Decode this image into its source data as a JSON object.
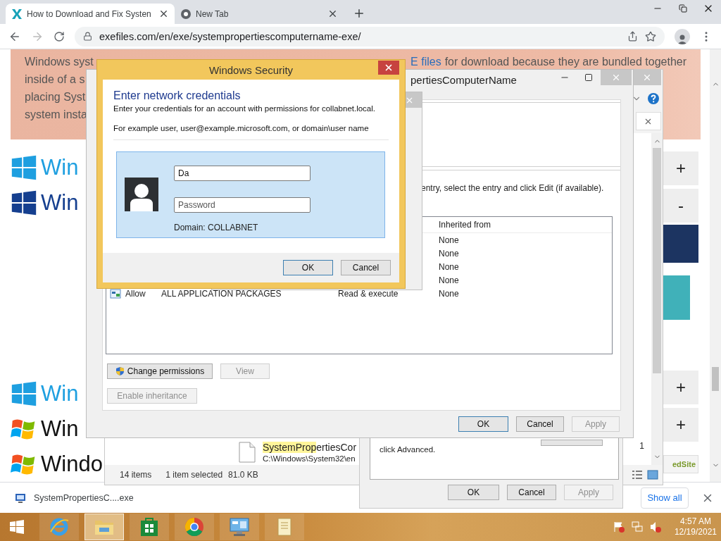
{
  "browser": {
    "tabs": [
      {
        "title": "How to Download and Fix Systen",
        "kind": "site",
        "selected": true
      },
      {
        "title": "New Tab",
        "kind": "newtab",
        "selected": false
      }
    ],
    "url": "exefiles.com/en/exe/systempropertiescomputername-exe/"
  },
  "page": {
    "banner_lines": [
      {
        "left": "Windows syst",
        "link": "E files",
        "right": "for download because they are bundled together"
      },
      {
        "left": "inside of a s"
      },
      {
        "left": "placing Syst"
      },
      {
        "left": "system insta"
      }
    ],
    "logos": [
      {
        "text": "Win",
        "kind": "ten"
      },
      {
        "text": "Win",
        "kind": "eight"
      },
      {
        "text": "Win",
        "kind": "ten"
      },
      {
        "text": "Win",
        "kind": "seven"
      },
      {
        "text": "Windo",
        "kind": "seven"
      }
    ],
    "side_buttons": [
      "+",
      "-",
      "+",
      "+"
    ],
    "badge": "edSite"
  },
  "download_bar": {
    "file": "SystemPropertiesC....exe",
    "show_all": "Show all"
  },
  "explorer": {
    "file_match": "SystemProp",
    "file_rest": "ertiesCor",
    "file_path": "C:\\Windows\\System32\\en",
    "side_digit": "1",
    "item_count": "14 items",
    "selection": "1 item selected",
    "size": "81.0 KB"
  },
  "file_properties": {
    "text": "click Advanced.",
    "buttons": [
      {
        "label": "OK",
        "default": false,
        "disabled": false
      },
      {
        "label": "Cancel",
        "default": false,
        "disabled": false
      },
      {
        "label": "Apply",
        "default": false,
        "disabled": true
      }
    ]
  },
  "properties_window": {
    "title": "pertiesComputerName",
    "instruction": "entry, select the entry and click Edit (if available).",
    "column": "Inherited from",
    "rows": [
      {
        "inherited": "None"
      },
      {
        "inherited": "None"
      },
      {
        "inherited": "None"
      },
      {
        "inherited": "None"
      },
      {
        "type": "Allow",
        "principal": "ALL APPLICATION PACKAGES",
        "access": "Read & execute",
        "inherited": "None"
      }
    ],
    "actions": [
      {
        "label": "Change permissions",
        "kind": "shield",
        "disabled": false
      },
      {
        "label": "View",
        "kind": "plain",
        "disabled": true
      },
      {
        "label": "Enable inheritance",
        "kind": "plain",
        "disabled": true
      }
    ],
    "footer": [
      {
        "label": "OK",
        "default": true,
        "disabled": false
      },
      {
        "label": "Cancel",
        "default": false,
        "disabled": false
      },
      {
        "label": "Apply",
        "default": false,
        "disabled": true
      }
    ]
  },
  "security_dialog": {
    "title": "Windows Security",
    "heading": "Enter network credentials",
    "description": "Enter your credentials for an account with permissions for collabnet.local.",
    "example": "For example user, user@example.microsoft.com, or domain\\user name",
    "username": "Da",
    "password_placeholder": "Password",
    "domain": "Domain: COLLABNET",
    "buttons": [
      {
        "label": "OK",
        "default": true
      },
      {
        "label": "Cancel",
        "default": false
      }
    ]
  },
  "taskbar": {
    "apps": [
      {
        "kind": "ie",
        "selected": false
      },
      {
        "kind": "explorer",
        "selected": true
      },
      {
        "kind": "store",
        "selected": false
      },
      {
        "kind": "chrome",
        "selected": false
      },
      {
        "kind": "control",
        "selected": false
      },
      {
        "kind": "notes",
        "selected": false
      }
    ],
    "time": "4:57 AM",
    "date": "12/19/2021"
  }
}
